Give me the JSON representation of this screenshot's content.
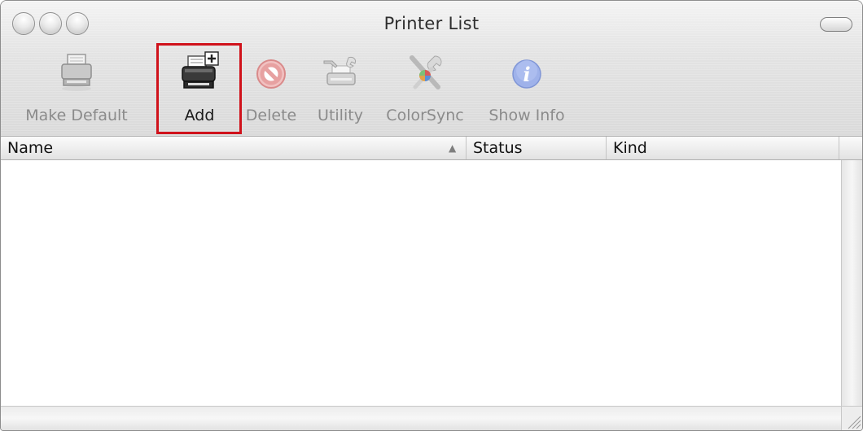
{
  "window": {
    "title": "Printer List"
  },
  "toolbar": {
    "items": [
      {
        "label": "Make Default",
        "icon": "printer-icon",
        "enabled": false
      },
      {
        "label": "Add",
        "icon": "add-printer-icon",
        "enabled": true,
        "highlighted": true
      },
      {
        "label": "Delete",
        "icon": "delete-icon",
        "enabled": false
      },
      {
        "label": "Utility",
        "icon": "utility-icon",
        "enabled": false
      },
      {
        "label": "ColorSync",
        "icon": "colorsync-icon",
        "enabled": false
      },
      {
        "label": "Show Info",
        "icon": "info-icon",
        "enabled": false
      }
    ],
    "highlight_color": "#d0121b"
  },
  "table": {
    "columns": [
      {
        "label": "Name",
        "sorted": "ascending"
      },
      {
        "label": "Status"
      },
      {
        "label": "Kind"
      }
    ],
    "rows": []
  }
}
